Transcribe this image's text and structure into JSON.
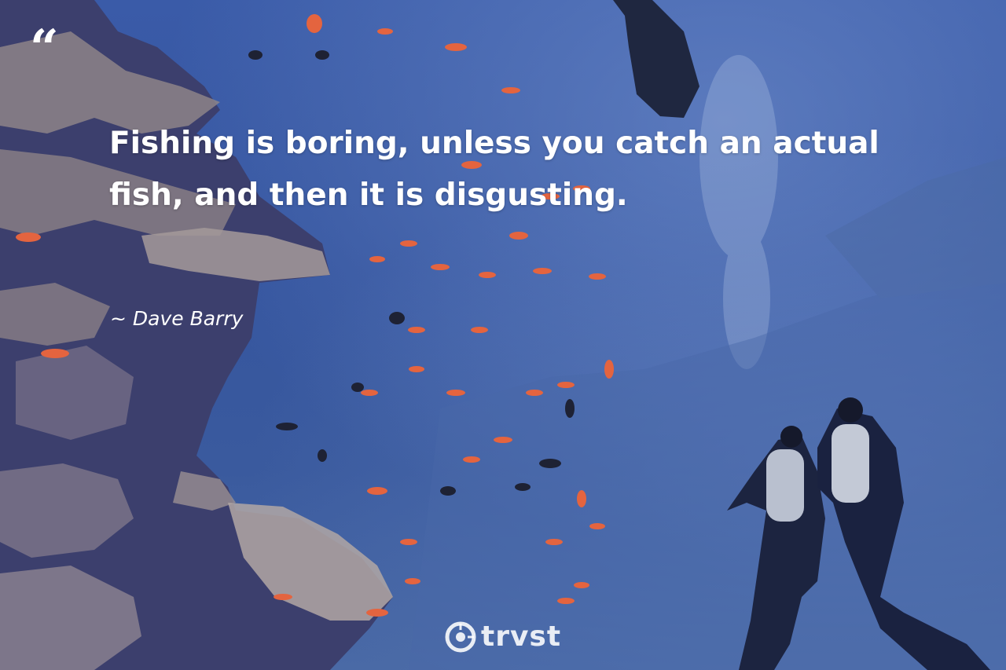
{
  "quote": {
    "mark": "“",
    "text": "Fishing is boring, unless you catch an actual fish, and then it is disgusting.",
    "author": "~ Dave Barry"
  },
  "brand": {
    "name": "trvst",
    "logo_icon": "trvst-logo-icon"
  },
  "colors": {
    "water": "#3a5ba8",
    "coral": "#8a7f86",
    "fish_orange": "#e4643f",
    "text": "#ffffff"
  }
}
